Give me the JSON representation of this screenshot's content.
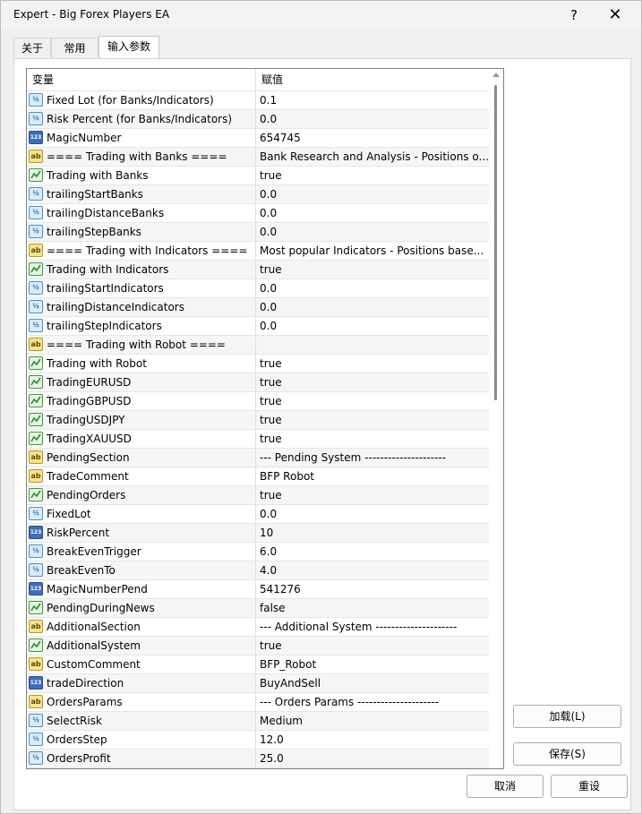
{
  "window": {
    "title": "Expert - Big Forex Players EA",
    "help_label": "?",
    "close_label": "✕"
  },
  "tabs": [
    {
      "label": "关于"
    },
    {
      "label": "常用"
    },
    {
      "label": "输入参数"
    }
  ],
  "grid": {
    "col_variable": "变量",
    "col_value": "赋值",
    "rows": [
      {
        "type": "double",
        "name": "Fixed Lot (for Banks/Indicators)",
        "value": "0.1"
      },
      {
        "type": "double",
        "name": "Risk Percent (for Banks/Indicators)",
        "value": "0.0"
      },
      {
        "type": "int",
        "name": "MagicNumber",
        "value": "654745"
      },
      {
        "type": "string",
        "name": "====  Trading with Banks ====",
        "value": "Bank Research and Analysis - Positions o..."
      },
      {
        "type": "bool",
        "name": "Trading with Banks",
        "value": "true"
      },
      {
        "type": "double",
        "name": "trailingStartBanks",
        "value": "0.0"
      },
      {
        "type": "double",
        "name": "trailingDistanceBanks",
        "value": "0.0"
      },
      {
        "type": "double",
        "name": "trailingStepBanks",
        "value": "0.0"
      },
      {
        "type": "string",
        "name": "==== Trading with Indicators ====",
        "value": "Most popular Indicators - Positions base..."
      },
      {
        "type": "bool",
        "name": "Trading with Indicators",
        "value": "true"
      },
      {
        "type": "double",
        "name": "trailingStartIndicators",
        "value": "0.0"
      },
      {
        "type": "double",
        "name": "trailingDistanceIndicators",
        "value": "0.0"
      },
      {
        "type": "double",
        "name": "trailingStepIndicators",
        "value": "0.0"
      },
      {
        "type": "string",
        "name": "==== Trading with Robot ====",
        "value": ""
      },
      {
        "type": "bool",
        "name": "Trading with Robot",
        "value": "true"
      },
      {
        "type": "bool",
        "name": "TradingEURUSD",
        "value": "true"
      },
      {
        "type": "bool",
        "name": "TradingGBPUSD",
        "value": "true"
      },
      {
        "type": "bool",
        "name": "TradingUSDJPY",
        "value": "true"
      },
      {
        "type": "bool",
        "name": "TradingXAUUSD",
        "value": "true"
      },
      {
        "type": "string",
        "name": "PendingSection",
        "value": "--- Pending System ---------------------"
      },
      {
        "type": "string",
        "name": "TradeComment",
        "value": "BFP Robot"
      },
      {
        "type": "bool",
        "name": "PendingOrders",
        "value": "true"
      },
      {
        "type": "double",
        "name": "FixedLot",
        "value": "0.0"
      },
      {
        "type": "int",
        "name": "RiskPercent",
        "value": "10"
      },
      {
        "type": "double",
        "name": "BreakEvenTrigger",
        "value": "6.0"
      },
      {
        "type": "double",
        "name": "BreakEvenTo",
        "value": "4.0"
      },
      {
        "type": "int",
        "name": "MagicNumberPend",
        "value": "541276"
      },
      {
        "type": "bool",
        "name": "PendingDuringNews",
        "value": "false"
      },
      {
        "type": "string",
        "name": "AdditionalSection",
        "value": "--- Additional System ---------------------"
      },
      {
        "type": "bool",
        "name": "AdditionalSystem",
        "value": "true"
      },
      {
        "type": "string",
        "name": "CustomComment",
        "value": "BFP_Robot"
      },
      {
        "type": "int",
        "name": "tradeDirection",
        "value": "BuyAndSell"
      },
      {
        "type": "string",
        "name": "OrdersParams",
        "value": "--- Orders Params ---------------------"
      },
      {
        "type": "enum",
        "name": "SelectRisk",
        "value": "Medium"
      },
      {
        "type": "double",
        "name": "OrdersStep",
        "value": "12.0"
      },
      {
        "type": "double",
        "name": "OrdersProfit",
        "value": "25.0"
      }
    ]
  },
  "buttons": {
    "load": "加载(L)",
    "save": "保存(S)",
    "cancel": "取消",
    "reset": "重设"
  },
  "icons": {
    "double": "½",
    "int": "123",
    "string": "ab",
    "bool": "check-chart-icon",
    "enum": "½"
  }
}
